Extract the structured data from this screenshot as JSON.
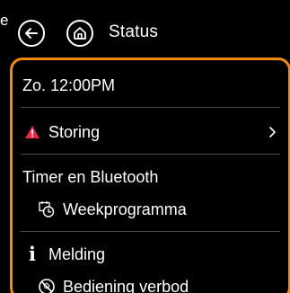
{
  "header": {
    "title": "Status",
    "edge_text": "e"
  },
  "items": {
    "datetime": "Zo. 12:00PM",
    "storing": "Storing",
    "timer_section": "Timer en Bluetooth",
    "week_program": "Weekprogramma",
    "melding_section": "Melding",
    "bediening": "Bediening verbod"
  },
  "colors": {
    "accent": "#f28a12",
    "warning": "#e8294a",
    "background": "#000000",
    "text": "#ffffff",
    "divider": "#4a4a4a"
  },
  "icons": {
    "back": "back-arrow-icon",
    "home": "home-icon",
    "warning": "warning-triangle-icon",
    "chevron": "chevron-right-icon",
    "clock": "calendar-clock-icon",
    "info": "info-icon",
    "prohibited": "prohibited-icon"
  }
}
